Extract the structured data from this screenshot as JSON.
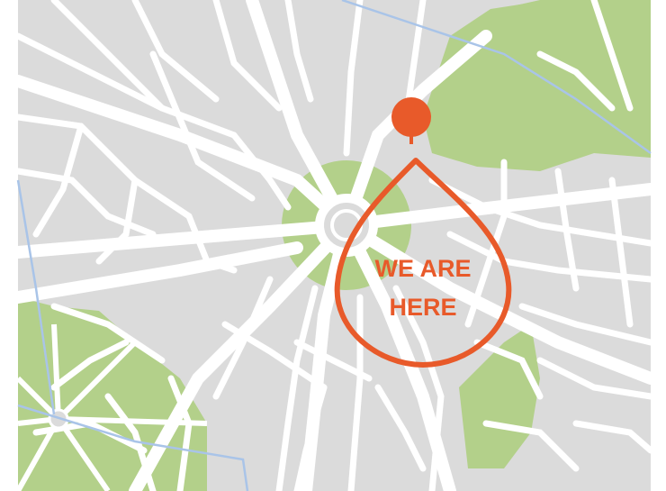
{
  "marker": {
    "label_line1": "WE ARE",
    "label_line2": "HERE"
  },
  "colors": {
    "land": "#dbdbdb",
    "park": "#b3d08a",
    "road": "#ffffff",
    "river": "#a9c4e8",
    "marker": "#e85a2a"
  },
  "icons": {
    "pin": "map-pin-icon",
    "callout": "teardrop-callout"
  }
}
